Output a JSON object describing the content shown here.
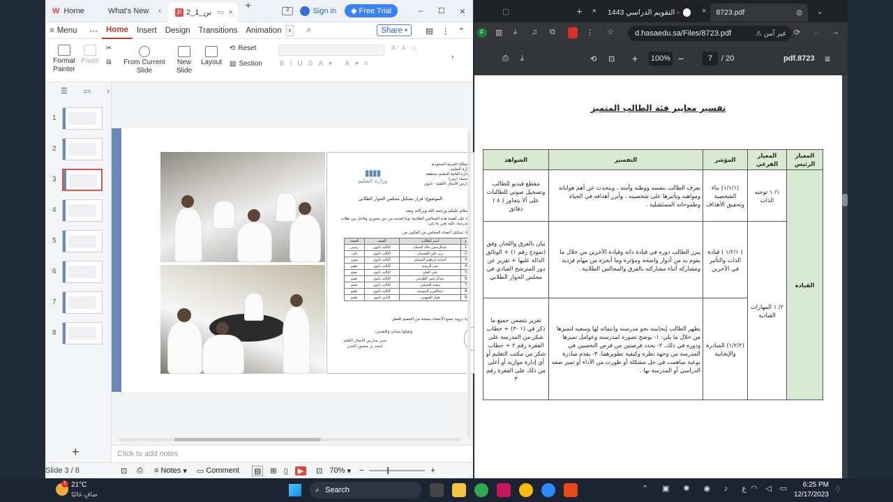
{
  "wps": {
    "tabs": {
      "home": "Home",
      "whats_new": "What's New",
      "doc": "بن_1_2",
      "signin": "Sign in",
      "free_trial": "Free Trial"
    },
    "menu": {
      "menu": "Menu",
      "home": "Home",
      "insert": "Insert",
      "design": "Design",
      "transitions": "Transitions",
      "animation": "Animation"
    },
    "ribbon": {
      "format_painter": "Format Painter",
      "paste": "Paste",
      "from_current": "From Current Slide",
      "new_slide": "New Slide",
      "layout": "Layout",
      "reset": "Reset",
      "section": "Section"
    },
    "share": "Share",
    "thumb_numbers": [
      "1",
      "2",
      "3",
      "4",
      "5",
      "6",
      "7",
      "8"
    ],
    "notes_placeholder": "Click to add notes",
    "status": {
      "slide": "Slide 3 / 8",
      "notes": "Notes",
      "comment": "Comment",
      "zoom": "70%"
    },
    "doc": {
      "ministry": "وزارة التعليم",
      "header_lines": [
        "المملكة العربية السعودية",
        "وزارة التعليم",
        "الإدارة العامة للتعليم بمنطقة",
        "الأحساء (بنين)",
        "مدارس الأنجال الأهلية - ثانوي"
      ],
      "subject": "الموضوع: قرار تشكيل مجلس الحوار الطلابي",
      "greeting": "السلام عليكم ورحمة الله وبركاته   وبعد",
      "body": "بناء على أهمية هذه المجالس الطلابية، وبنا لقدمه من دور محوري وفاعل بين طلاب المدرسة، عليه تقرر ما يلي:",
      "subhead": "أولا: تشكيل أعضاء المجلس من المكون من:",
      "table_header": [
        "م",
        "اسم الطالب",
        "الصف",
        "الصفة"
      ],
      "rows": [
        [
          "1",
          "عبدالرحمن خالد الحمام",
          "الثالث ثانوي",
          "رئيس"
        ],
        [
          "2",
          "يزن علي العسبيان",
          "الثالث ثانوي",
          "نائب"
        ],
        [
          "3",
          "أسامة إبراهيم المسلم",
          "الثالث ثانوي",
          "مقرر"
        ],
        [
          "4",
          "عمر الرشيد",
          "الثالث ثانوي",
          "عضو"
        ],
        [
          "5",
          "علي العلي",
          "الثالث ثانوي",
          "عضو"
        ],
        [
          "6",
          "عبدالرحمن الطرفي",
          "الثالث ثانوي",
          "عضو"
        ],
        [
          "7",
          "سعيد الشيخي",
          "الثالث ثانوي",
          "عضو"
        ],
        [
          "8",
          "عبدالعزيز الموسيد",
          "الثالث ثانوي",
          "عضو"
        ],
        [
          "9",
          "فواز الشهيبي",
          "الثاني ثانوي",
          "عضو"
        ]
      ],
      "footer": "ثانيا: تزويد جميع الأعضاء بنسخة من التعميم للعمل",
      "closing": "وتقبلوا تحياتي والتقدير،،",
      "sign": "مدير مدارس الأنجال الأهلية",
      "signer": "أسعد بن منصور الغدير"
    }
  },
  "browser": {
    "tabs": {
      "search": "التقويم الدراسي 1443 - Search",
      "pdf": "8723.pdf"
    },
    "security": "غير آمن",
    "url": "d.hasaedu.sa/Files/8723.pdf",
    "zoom": "100%",
    "page_current": "7",
    "page_total": "/ 20",
    "file_title": "pdf.8723"
  },
  "pdf": {
    "title": "تفسير معايير فئة الطالب المتميز",
    "headers": [
      "المعيار الرئيس",
      "المعيار الفرعي",
      "المؤشر",
      "التفسير",
      "الشواهد"
    ],
    "main": "القيادة",
    "sub1": "١/ ١ توجيه الذات",
    "sub2": "٢/ ١ المهارات القيادية",
    "rows": [
      {
        "indicator": "(١/١/١) بناء الشخصية وتحقيق الأهداف",
        "explanation": "يعرف الطالب بنفسه ووطنه وأمته ، ويتحدث عن أهم هواياته ومواهبه وتأثيرها على شخصيته ، وأبرز أهدافه في الحياة وطموحاته المستقبلية .",
        "evidence": "مقطع فيديو للطالب وتسجيل صوتي للطالبات على ألا يتجاوز ( ٨ ) دقائق"
      },
      {
        "indicator": "( ١/٢/١ ) قيادة الذات والتأثير في الآخرين",
        "explanation": "يبرز الطالب دوره في قيادة ذاته وقيادة الآخرين من خلال ما يقوم به من أدوار واضحة ومؤثرة وما أنجزه من مهام فردية ومشاركة أثناء مشاركته بالفرق والمجالس الطلابية .",
        "evidence": "بيان بالفرق واللجان وفق (نموذج رقم ١) + الوثائق الدالة عليها + تقرير عن دور المترشح القيادي في مجلس الحوار الطلابي"
      },
      {
        "indicator": "(١/٢/٢) المبادرة والإيجابية",
        "explanation": "يظهر الطالب إيجابيته نحو مدرسته وانتمائه لها وسعيه لتميزها من خلال ما يلي: ١- يوضح تصوره لمدرسته وعوامل تميزها ودوره في ذلك. ٢- يحدد فرصتين من فرص التحسين في المدرسة من وجهة نظره وكيفية تطويرهما. ٣- يقدم مبادرة نوعية ساهمت في حل مشكلة أو طورت من الأداء أو تميز صفه الدراسي أو المدرسة بها .",
        "evidence": "تقرير يتضمن جميع ما ذكر في (١ -٣) + خطاب شكر من المدرسة على الفقرة رقم ٢ + خطاب شكر من مكتب التعليم أو أي إدارة موازية أو أعلى من ذلك على الفقرة رقم ٣"
      }
    ]
  },
  "taskbar": {
    "weather_temp": "21°C",
    "weather_desc": "صافٍ غالبًا",
    "search": "Search",
    "lang": "ع",
    "time": "6:25 PM",
    "date": "12/17/2023",
    "badge": "1"
  }
}
